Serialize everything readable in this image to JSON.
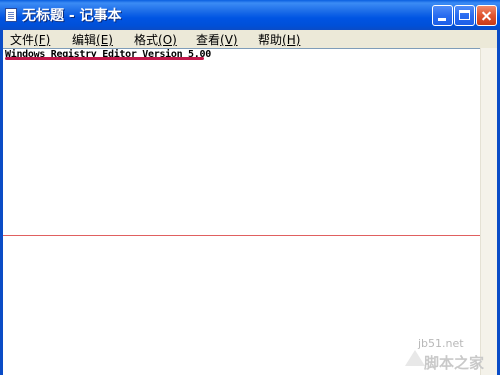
{
  "window": {
    "title": "无标题 - 记事本"
  },
  "titlebar_buttons": {
    "minimize": "minimize",
    "maximize": "maximize",
    "close": "close"
  },
  "menu": {
    "items": [
      {
        "label": "文件",
        "key": "(F)"
      },
      {
        "label": "编辑",
        "key": "(E)"
      },
      {
        "label": "格式",
        "key": "(O)"
      },
      {
        "label": "查看",
        "key": "(V)"
      },
      {
        "label": "帮助",
        "key": "(H)"
      }
    ]
  },
  "document": {
    "first_line": "Windows Registry Editor Version 5.00"
  },
  "colors": {
    "titlebar": "#0054e3",
    "menubar": "#ece9d8",
    "highlight_underline": "#c0184a",
    "guide_line": "#e06060"
  },
  "watermark": {
    "site": "jb51.net",
    "logo": "脚本之家"
  }
}
